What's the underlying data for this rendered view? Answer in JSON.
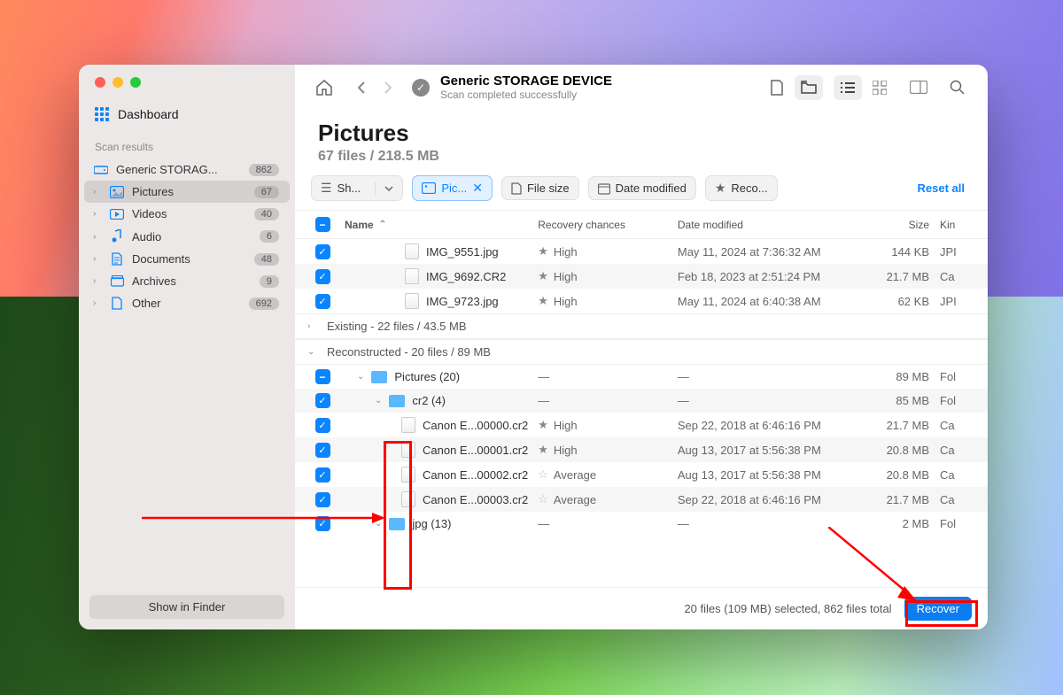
{
  "sidebar": {
    "dashboard_label": "Dashboard",
    "section_label": "Scan results",
    "device": {
      "label": "Generic STORAG...",
      "count": "862"
    },
    "items": [
      {
        "label": "Pictures",
        "count": "67"
      },
      {
        "label": "Videos",
        "count": "40"
      },
      {
        "label": "Audio",
        "count": "6"
      },
      {
        "label": "Documents",
        "count": "48"
      },
      {
        "label": "Archives",
        "count": "9"
      },
      {
        "label": "Other",
        "count": "692"
      }
    ],
    "footer_button": "Show in Finder"
  },
  "toolbar": {
    "title": "Generic STORAGE DEVICE",
    "subtitle": "Scan completed successfully"
  },
  "page": {
    "title": "Pictures",
    "subtitle": "67 files / 218.5 MB"
  },
  "filters": {
    "show": "Sh...",
    "pictures": "Pic...",
    "file_size": "File size",
    "date_modified": "Date modified",
    "recovery": "Reco...",
    "reset": "Reset all"
  },
  "columns": {
    "name": "Name",
    "recovery": "Recovery chances",
    "date": "Date modified",
    "size": "Size",
    "kind": "Kin"
  },
  "top_rows": [
    {
      "name": "IMG_9551.jpg",
      "recov": "High",
      "date": "May 11, 2024 at 7:36:32 AM",
      "size": "144 KB",
      "kind": "JPI"
    },
    {
      "name": "IMG_9692.CR2",
      "recov": "High",
      "date": "Feb 18, 2023 at 2:51:24 PM",
      "size": "21.7 MB",
      "kind": "Ca"
    },
    {
      "name": "IMG_9723.jpg",
      "recov": "High",
      "date": "May 11, 2024 at 6:40:38 AM",
      "size": "62 KB",
      "kind": "JPI"
    }
  ],
  "group_existing": "Existing - 22 files / 43.5 MB",
  "group_reconstructed": "Reconstructed - 20 files / 89 MB",
  "folder_pictures": {
    "name": "Pictures (20)",
    "size": "89 MB",
    "kind": "Fol"
  },
  "folder_cr2": {
    "name": "cr2 (4)",
    "size": "85 MB",
    "kind": "Fol"
  },
  "cr2_rows": [
    {
      "name": "Canon E...00000.cr2",
      "recov": "High",
      "star": "full",
      "date": "Sep 22, 2018 at 6:46:16 PM",
      "size": "21.7 MB",
      "kind": "Ca"
    },
    {
      "name": "Canon E...00001.cr2",
      "recov": "High",
      "star": "full",
      "date": "Aug 13, 2017 at 5:56:38 PM",
      "size": "20.8 MB",
      "kind": "Ca"
    },
    {
      "name": "Canon E...00002.cr2",
      "recov": "Average",
      "star": "outline",
      "date": "Aug 13, 2017 at 5:56:38 PM",
      "size": "20.8 MB",
      "kind": "Ca"
    },
    {
      "name": "Canon E...00003.cr2",
      "recov": "Average",
      "star": "outline",
      "date": "Sep 22, 2018 at 6:46:16 PM",
      "size": "21.7 MB",
      "kind": "Ca"
    }
  ],
  "folder_jpg": {
    "name": "jpg (13)",
    "size": "2 MB",
    "kind": "Fol"
  },
  "footer": {
    "status": "20 files (109 MB) selected, 862 files total",
    "recover": "Recover"
  }
}
